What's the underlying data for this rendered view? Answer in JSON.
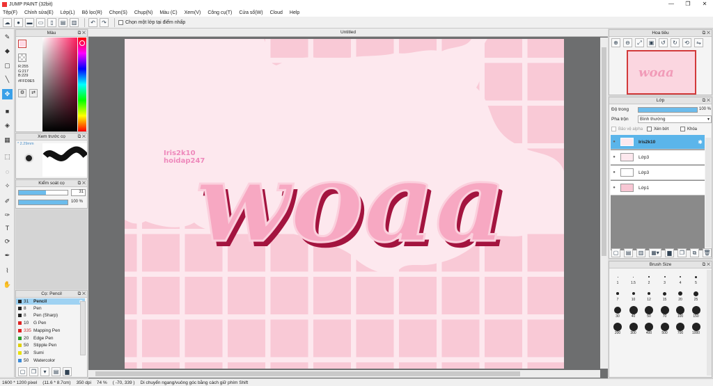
{
  "app": {
    "title": "JUMP PAINT (32bit)",
    "window_controls": [
      "—",
      "❐",
      "✕"
    ]
  },
  "menu": [
    "Tệp(F)",
    "Chỉnh sửa(E)",
    "Lớp(L)",
    "Bộ lọc(R)",
    "Chọn(S)",
    "Chụp(N)",
    "Màu (C)",
    "Xem(V)",
    "Công cụ(T)",
    "Cửa sổ(W)",
    "Cloud",
    "Help"
  ],
  "toolbar": {
    "checkbox_label": "Chọn một lớp tại điểm nhấp"
  },
  "color_panel": {
    "title": "Màu",
    "r": "R:255",
    "g": "G:217",
    "b": "B:229",
    "hex": "#FFD9E5",
    "fg_color": "#ffd9e5"
  },
  "preview_panel": {
    "title": "Xem trước cọ",
    "size": "* 2.29mm"
  },
  "brush_control": {
    "title": "Kiểm soát cọ",
    "size_value": "31",
    "opacity_value": "100 %"
  },
  "brush_list": {
    "title": "Cọ: Pencil",
    "items": [
      {
        "size": "31",
        "name": "Pencil",
        "color": "#222222",
        "selected": true
      },
      {
        "size": "8",
        "name": "Pen",
        "color": "#222222"
      },
      {
        "size": "8",
        "name": "Pen (Sharp)",
        "color": "#222222"
      },
      {
        "size": "10",
        "name": "G Pen",
        "color": "#dd2222"
      },
      {
        "size": "335",
        "name": "Mapping Pen",
        "color": "#dd2222"
      },
      {
        "size": "20",
        "name": "Edge Pen",
        "color": "#eeaa00"
      },
      {
        "size": "50",
        "name": "Stipple Pen",
        "color": "#e0d000"
      },
      {
        "size": "30",
        "name": "Sumi",
        "color": "#e8e000"
      },
      {
        "size": "50",
        "name": "Watercolor",
        "color": "#3a8ad8"
      }
    ]
  },
  "document": {
    "tab": "Untitled",
    "watermark_line1": "Iris2k10",
    "watermark_line2": "hoidap247",
    "art_text": "woaa"
  },
  "navigator": {
    "title": "Hoa tiêu",
    "buttons": [
      "zoom-in",
      "zoom-out",
      "fit",
      "actual",
      "rotate-left",
      "rotate-right",
      "reset",
      "flip"
    ]
  },
  "layer_panel": {
    "title": "Lớp",
    "opacity_label": "Độ trong",
    "opacity_value": "100 %",
    "opacity_percent": 100,
    "blend_label": "Pha trộn",
    "blend_value": "Bình thường",
    "protect_alpha": "Bảo vệ alpha",
    "clipping": "Xén bớt",
    "lock": "Khóa",
    "layers": [
      {
        "name": "Iris2k10",
        "selected": true
      },
      {
        "name": "Lớp3"
      },
      {
        "name": "Lớp3"
      },
      {
        "name": "Lớp1"
      }
    ]
  },
  "brush_size": {
    "title": "Brush Size",
    "sizes": [
      "1",
      "1.5",
      "2",
      "3",
      "4",
      "5",
      "7",
      "10",
      "12",
      "15",
      "20",
      "25",
      "30",
      "40",
      "50",
      "70",
      "100",
      "150",
      "200",
      "300",
      "400",
      "500",
      "700",
      "1000"
    ]
  },
  "status": {
    "dimensions": "1600 * 1200 pixel",
    "physical": "(11.6 * 8.7cm)",
    "dpi": "350 dpi",
    "zoom": "74 %",
    "coords": "( -70, 339 )",
    "hint": "Di chuyển ngang/vuông góc bằng cách giữ phím Shift"
  },
  "colors": {
    "canvas_bg": "#fde8ee",
    "grid_pink": "#f9c9d6",
    "text_pink": "#f7a8c2",
    "text_shadow": "#a3143f",
    "watermark": "#ee88bb",
    "accent_blue": "#3aa0e8"
  }
}
